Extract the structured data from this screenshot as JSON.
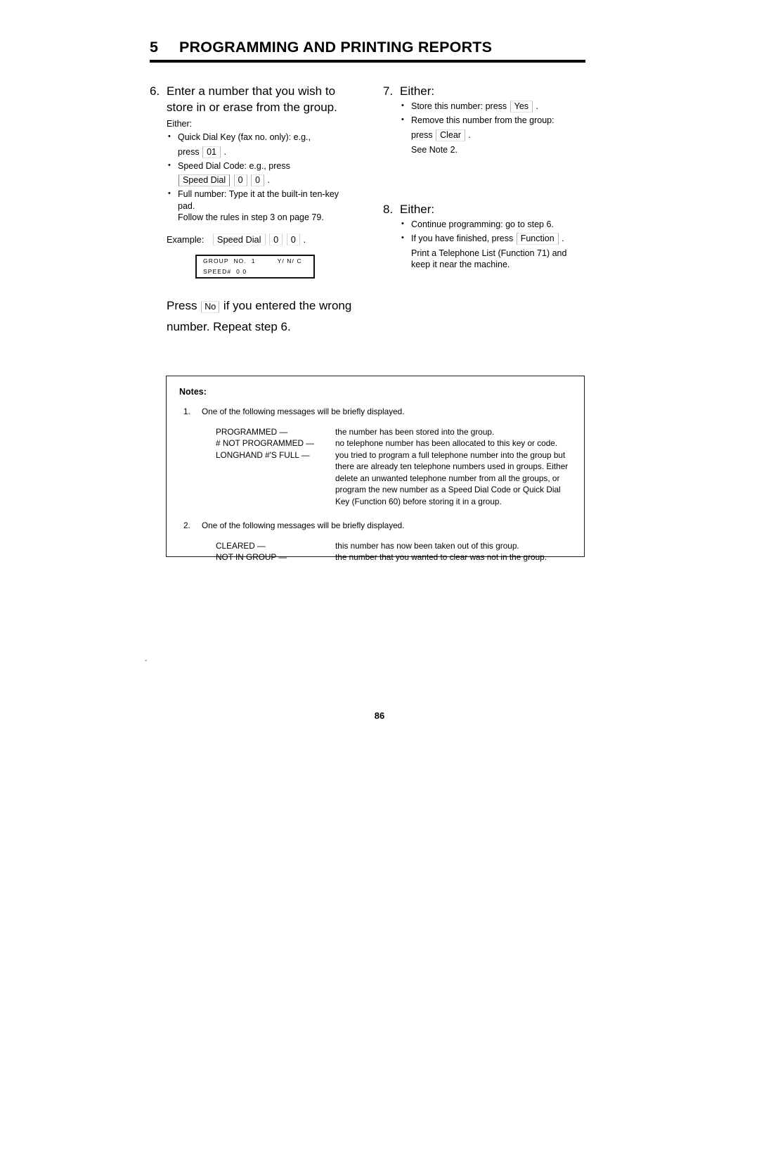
{
  "header": {
    "chapter_number": "5",
    "chapter_title": "PROGRAMMING AND PRINTING REPORTS"
  },
  "left_column": {
    "step6": {
      "number": "6.",
      "title": "Enter a number that you wish to store in or erase from the group.",
      "either_label": "Either:",
      "bullets": [
        {
          "lead": "Quick Dial Key (fax no. only): e.g.,",
          "press_label": "press",
          "key": "01",
          "trailing": "."
        },
        {
          "lead": "Speed Dial Code: e.g., press",
          "keys": [
            "Speed Dial",
            "0",
            "0"
          ],
          "trailing": "."
        },
        {
          "lead": "Full number: Type it at the built-in ten-key pad.",
          "cont": "Follow the rules in step 3 on page 79."
        }
      ],
      "example": {
        "label": "Example:",
        "keys": [
          "Speed Dial",
          "0",
          "0"
        ],
        "trailing": "."
      }
    },
    "lcd": {
      "line1": "GROUP  NO.  1         Y/ N/ C",
      "line2": "SPEED#  0 0"
    },
    "press_no": {
      "press_label": "Press",
      "key": "No",
      "text_after": "if you entered the wrong number. Repeat step 6."
    }
  },
  "right_column": {
    "step7": {
      "number": "7.",
      "title": "Either:",
      "bullets": [
        {
          "lead": "Store this number: press",
          "key": "Yes",
          "trailing": "."
        },
        {
          "lead": "Remove this number from the group:",
          "press_label": "press",
          "key": "Clear",
          "trailing": ".",
          "cont": "See Note 2."
        }
      ]
    },
    "step8": {
      "number": "8.",
      "title": "Either:",
      "bullets": [
        {
          "lead": "Continue programming: go to step 6."
        },
        {
          "lead": "If you have finished, press",
          "key": "Function",
          "trailing": ".",
          "cont": "Print a Telephone List (Function 71) and keep it near the machine."
        }
      ]
    }
  },
  "notes": {
    "title": "Notes:",
    "items": [
      {
        "index": "1.",
        "lead": "One of the following messages will be briefly displayed.",
        "messages": [
          {
            "term": "PROGRAMMED —",
            "desc": "the number has been stored into the group."
          },
          {
            "term": "# NOT PROGRAMMED —",
            "desc": "no telephone number has been allocated to this key or code."
          },
          {
            "term": "LONGHAND #'S FULL —",
            "desc": "you tried to program a full telephone number into the group but there are already ten telephone numbers used in groups. Either delete an unwanted telephone number from all the groups, or program the new number as a Speed Dial Code or Quick Dial Key (Function 60) before storing it in a group."
          }
        ]
      },
      {
        "index": "2.",
        "lead": "One of the following messages will be briefly displayed.",
        "messages": [
          {
            "term": "CLEARED —",
            "desc": "this number has now been taken out of this group."
          },
          {
            "term": "NOT IN GROUP —",
            "desc": "the number that you wanted to clear was not in the group."
          }
        ]
      }
    ]
  },
  "footer": {
    "page_number": "86"
  }
}
